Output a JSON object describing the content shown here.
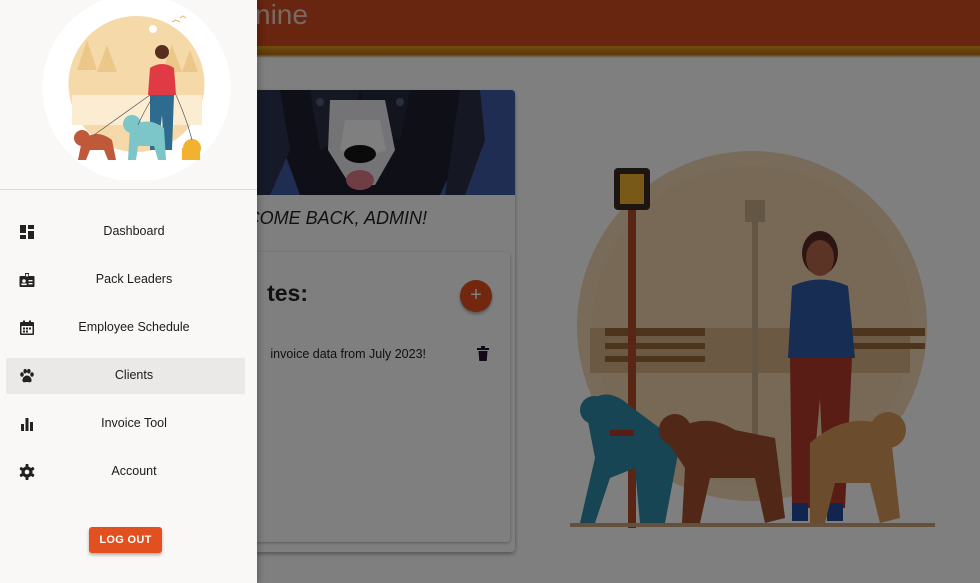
{
  "appbar": {
    "title_fragment": "nine"
  },
  "card": {
    "heading": "COME BACK, ADMIN!",
    "notes_title_fragment": "tes:",
    "add_label": "+",
    "note_text": "invoice data from July 2023!"
  },
  "drawer": {
    "items": [
      {
        "label": "Dashboard",
        "icon": "dashboard-icon",
        "active": false
      },
      {
        "label": "Pack Leaders",
        "icon": "badge-icon",
        "active": false
      },
      {
        "label": "Employee Schedule",
        "icon": "calendar-icon",
        "active": false
      },
      {
        "label": "Clients",
        "icon": "paw-icon",
        "active": true
      },
      {
        "label": "Invoice Tool",
        "icon": "bar-chart-icon",
        "active": false
      },
      {
        "label": "Account",
        "icon": "gear-icon",
        "active": false
      }
    ],
    "logout_label": "LOG OUT"
  },
  "colors": {
    "primary": "#e3501f",
    "appbar": "#d14a1e",
    "accent_stripe": "#e39a1a",
    "drawer_bg": "#faf8f6",
    "active_item_bg": "#ebe9e7"
  }
}
